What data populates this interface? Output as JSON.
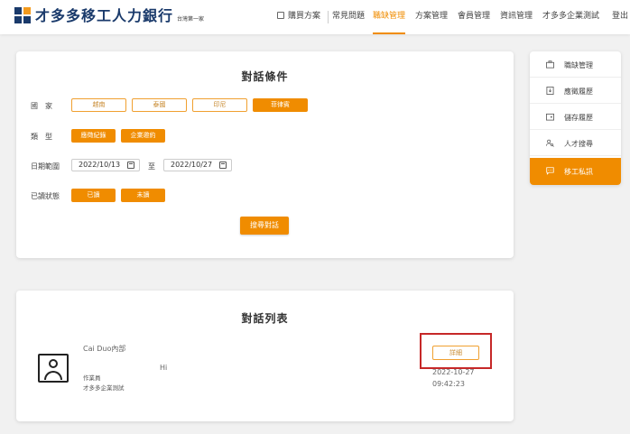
{
  "brand": {
    "name": "才多多移工人力銀行",
    "tagline": "台灣第一家"
  },
  "nav": {
    "items": [
      "購買方案",
      "常見問題",
      "職缺管理",
      "方案管理",
      "會員管理",
      "資訊管理",
      "才多多企業測試",
      "登出"
    ],
    "active": "職缺管理"
  },
  "filter": {
    "title": "對話條件",
    "country_label": "國　家",
    "countries": [
      "越南",
      "泰國",
      "印尼",
      "菲律賓"
    ],
    "selected_country": "菲律賓",
    "type_label": "類　型",
    "types": [
      "應徵紀錄",
      "企業邀約"
    ],
    "date_label": "日期範圍",
    "date_from": "2022/10/13",
    "date_to_label": "至",
    "date_to": "2022/10/27",
    "read_label": "已讀狀態",
    "read_options": [
      "已讀",
      "未讀"
    ],
    "search_button": "搜尋對話"
  },
  "sidebar": {
    "items": [
      {
        "label": "職缺管理",
        "icon": "briefcase-icon"
      },
      {
        "label": "應徵履歷",
        "icon": "document-download-icon"
      },
      {
        "label": "儲存履歷",
        "icon": "folder-icon"
      },
      {
        "label": "人才搜尋",
        "icon": "people-search-icon"
      },
      {
        "label": "移工私訊",
        "icon": "chat-icon"
      }
    ],
    "active": "移工私訊"
  },
  "list": {
    "title": "對話列表",
    "conversation": {
      "name": "Cai Duo內部",
      "role": "作業員",
      "company": "才多多企業測試",
      "message": "Hi",
      "date": "2022-10-27",
      "time": "09:42:23",
      "detail_button": "詳細"
    }
  },
  "colors": {
    "accent": "#f08c00",
    "brand": "#1a3a6b",
    "highlight": "#c62828"
  }
}
